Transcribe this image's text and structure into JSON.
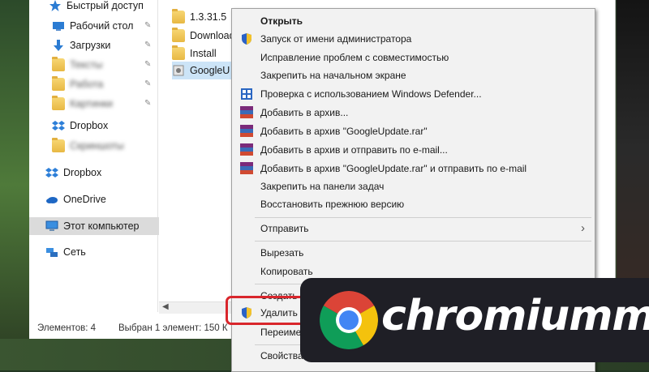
{
  "nav": {
    "quick_access": "Быстрый доступ",
    "desktop": "Рабочий стол",
    "downloads": "Загрузки",
    "blurred1": "Тексты",
    "blurred2": "Работа",
    "blurred3": "Картинки",
    "dropbox_pinned": "Dropbox",
    "blurred4": "Скриншоты",
    "dropbox": "Dropbox",
    "onedrive": "OneDrive",
    "this_pc": "Этот компьютер",
    "network": "Сеть"
  },
  "files": [
    {
      "name": "1.3.31.5",
      "type": "folder"
    },
    {
      "name": "Download",
      "type": "folder"
    },
    {
      "name": "Install",
      "type": "folder"
    },
    {
      "name": "GoogleU",
      "type": "file"
    }
  ],
  "status": {
    "elements": "Элементов: 4",
    "selected": "Выбран 1 элемент: 150 К"
  },
  "context_menu": {
    "open": "Открыть",
    "run_as_admin": "Запуск от имени администратора",
    "troubleshoot": "Исправление проблем с совместимостью",
    "pin_start": "Закрепить на начальном экране",
    "defender": "Проверка с использованием Windows Defender...",
    "add_archive": "Добавить в архив...",
    "add_rar": "Добавить в архив \"GoogleUpdate.rar\"",
    "add_email": "Добавить в архив и отправить по e-mail...",
    "add_rar_email": "Добавить в архив \"GoogleUpdate.rar\" и отправить по e-mail",
    "pin_taskbar": "Закрепить на панели задач",
    "restore": "Восстановить прежнюю версию",
    "send_to": "Отправить",
    "cut": "Вырезать",
    "copy": "Копировать",
    "create_shortcut": "Создать ярлык",
    "delete": "Удалить",
    "rename": "Переименовать",
    "properties": "Свойства"
  },
  "brand": {
    "name": "chromiumm"
  },
  "colors": {
    "highlight_border": "#d9262c",
    "banner_bg": "#1f1f26",
    "selection": "#cce4f7"
  }
}
